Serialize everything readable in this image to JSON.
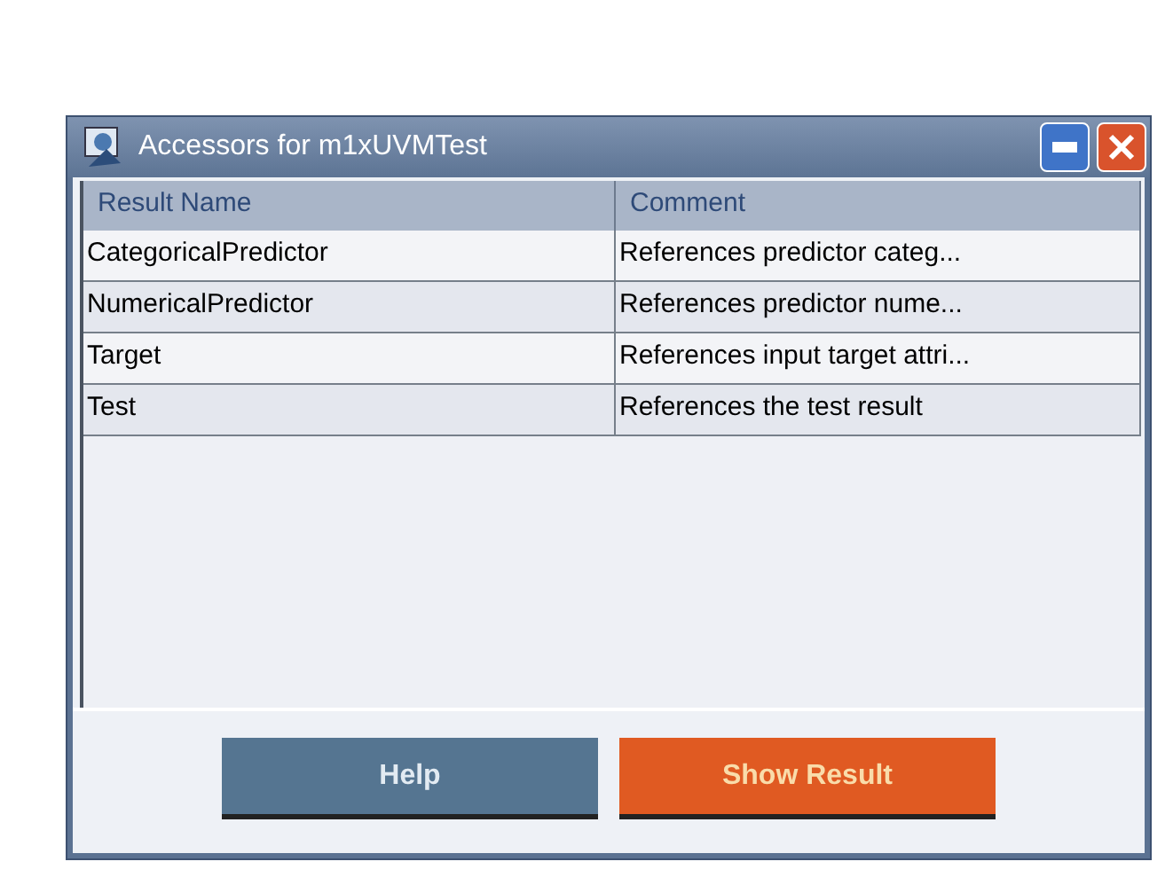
{
  "window": {
    "title": "Accessors for m1xUVMTest"
  },
  "table": {
    "columns": [
      "Result Name",
      "Comment"
    ],
    "rows": [
      [
        "CategoricalPredictor",
        "References predictor categ..."
      ],
      [
        "NumericalPredictor",
        "References predictor nume..."
      ],
      [
        "Target",
        "References input target attri..."
      ],
      [
        "Test",
        "References the test result"
      ]
    ]
  },
  "buttons": [
    {
      "label": "Help",
      "kind": "secondary"
    },
    {
      "label": "Show Result",
      "kind": "primary"
    }
  ]
}
